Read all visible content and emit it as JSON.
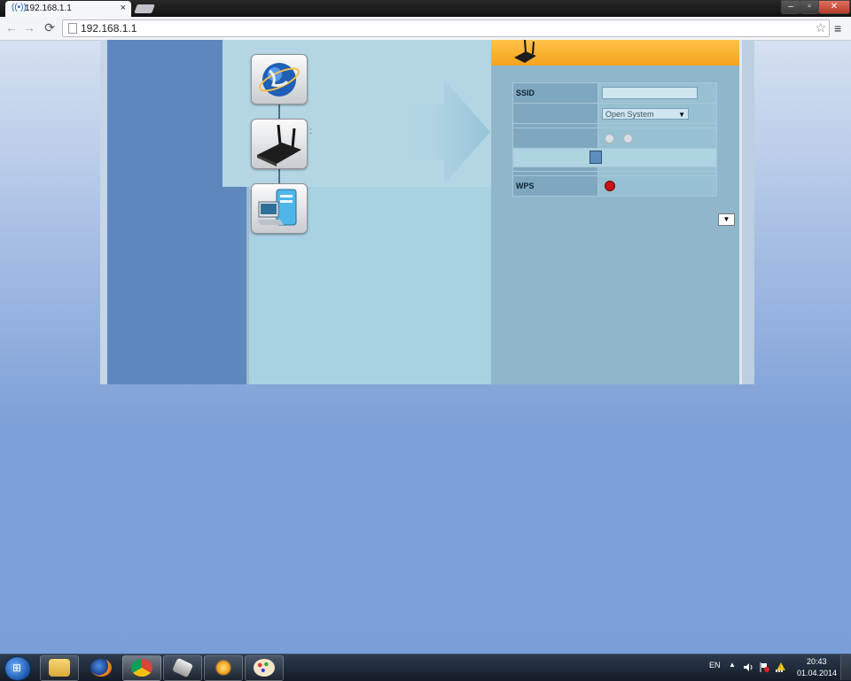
{
  "browser": {
    "tab_title": "192.168.1.1",
    "tab_close": "×",
    "url": "192.168.1.1",
    "icons": {
      "back": "←",
      "forward": "→",
      "reload": "⟳",
      "bookmark": "☆",
      "menu": "≡"
    }
  },
  "window_controls": {
    "minimize": "–",
    "maximize": "▫",
    "close": "✕"
  },
  "router_page": {
    "topology_colon": ":",
    "table": {
      "ssid_label": "SSID",
      "ssid_value": "",
      "auth_value": "Open System",
      "wps_label": "WPS"
    },
    "dropdown_caret": "▼",
    "colors": {
      "header": "#f7a923",
      "nav": "#5e87bd",
      "panel": "#8fb6cb"
    }
  },
  "taskbar": {
    "language": "EN",
    "tray_expand": "▲",
    "time": "20:43",
    "date": "01.04.2014",
    "pinned": [
      "explorer-icon",
      "firefox-icon",
      "chrome-icon",
      "app-icon",
      "sparkle-app-icon",
      "paint-icon"
    ]
  }
}
